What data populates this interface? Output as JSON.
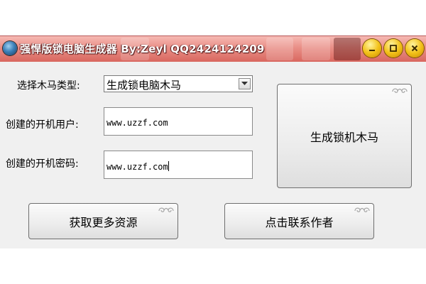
{
  "window": {
    "title": "强悍版锁电脑生成器 By:Zeyl QQ2424124209"
  },
  "form": {
    "type_label": "选择木马类型:",
    "type_value": "生成锁电脑木马",
    "user_label": "创建的开机用户:",
    "user_value": "www.uzzf.com",
    "password_label": "创建的开机密码:",
    "password_value": "www.uzzf.com"
  },
  "buttons": {
    "generate": "生成锁机木马",
    "more_resources": "获取更多资源",
    "contact_author": "点击联系作者"
  },
  "title_controls": [
    "minimize-icon",
    "maximize-icon",
    "close-icon"
  ],
  "colors": {
    "titlebar": "#e98e86",
    "window_bg": "#f0f0f0",
    "control_buttons": "#f3c21a"
  }
}
